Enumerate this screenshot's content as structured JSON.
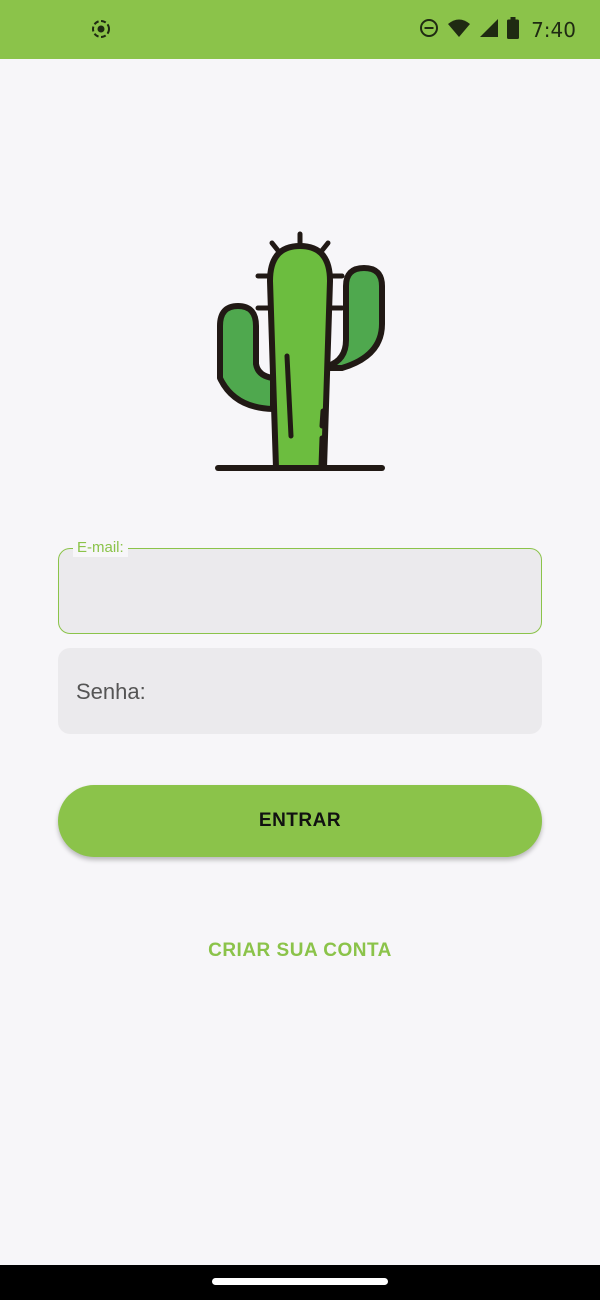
{
  "status_bar": {
    "time": "7:40",
    "icons": [
      "screen-record-icon",
      "do-not-disturb-icon",
      "wifi-icon",
      "signal-icon",
      "battery-icon"
    ],
    "background": "#8bc34a"
  },
  "logo": {
    "icon": "cactus-icon"
  },
  "form": {
    "email": {
      "label": "E-mail:",
      "value": ""
    },
    "password": {
      "placeholder": "Senha:",
      "value": ""
    }
  },
  "actions": {
    "login_label": "ENTRAR",
    "create_account_label": "CRIAR SUA CONTA"
  },
  "colors": {
    "accent": "#8bc34a",
    "background": "#f7f6f9",
    "field_bg": "#ebeaed"
  }
}
